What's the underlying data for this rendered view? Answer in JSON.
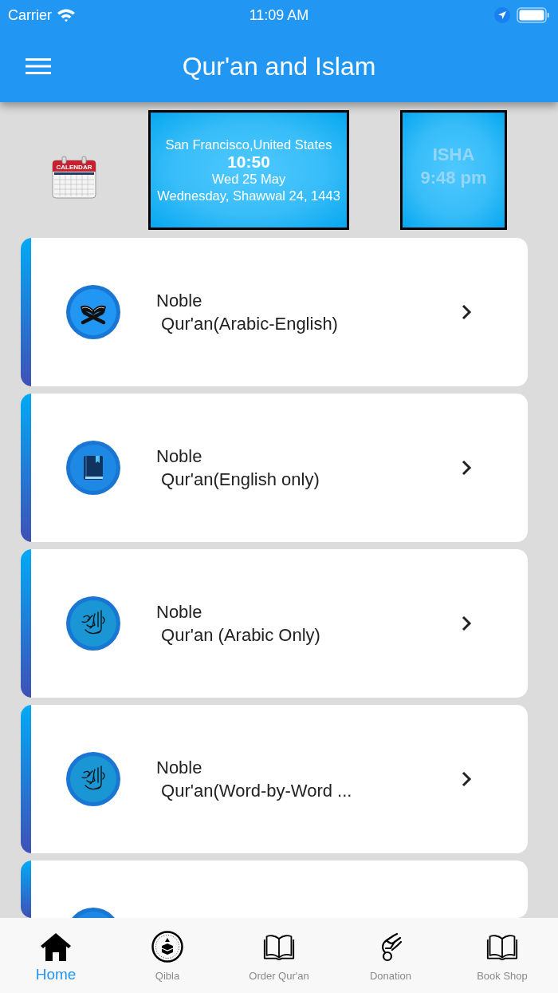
{
  "status_bar": {
    "carrier": "Carrier",
    "time": "11:09 AM"
  },
  "app_bar": {
    "title": "Qur'an and Islam"
  },
  "header": {
    "calendar_label": "CALENDAR",
    "location": "San Francisco,United States",
    "time": "10:50",
    "date": "Wed 25 May",
    "hijri_date": "Wednesday, Shawwal 24, 1443",
    "prayer": {
      "name": "ISHA",
      "time": "9:48 pm"
    }
  },
  "menu": [
    {
      "kind": "stand",
      "title": "Noble\n Qur'an(Arabic-English)"
    },
    {
      "kind": "book",
      "title": "Noble\n Qur'an(English only)"
    },
    {
      "kind": "calligraphy",
      "title": "Noble\n Qur'an (Arabic Only)"
    },
    {
      "kind": "calligraphy",
      "title": "Noble\n Qur'an(Word-by-Word ..."
    },
    {
      "kind": "partial"
    }
  ],
  "tabs": [
    {
      "kind": "home",
      "label": "Home",
      "selected": true
    },
    {
      "kind": "compass",
      "label": "Qibla",
      "selected": false
    },
    {
      "kind": "book",
      "label": "Order Qur'an",
      "selected": false
    },
    {
      "kind": "hand",
      "label": "Donation",
      "selected": false
    },
    {
      "kind": "book",
      "label": "Book Shop",
      "selected": false
    }
  ]
}
